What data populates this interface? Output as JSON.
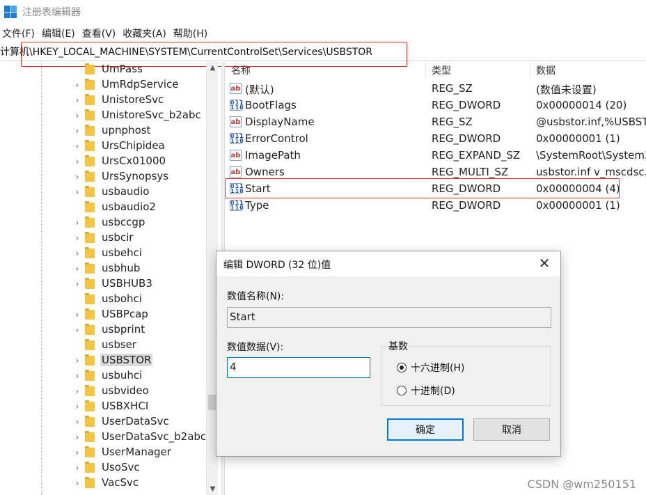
{
  "window": {
    "title": "注册表编辑器"
  },
  "menu": [
    {
      "label": "文件(F)"
    },
    {
      "label": "编辑(E)"
    },
    {
      "label": "查看(V)"
    },
    {
      "label": "收藏夹(A)"
    },
    {
      "label": "帮助(H)"
    }
  ],
  "address": {
    "path": "计算机\\HKEY_LOCAL_MACHINE\\SYSTEM\\CurrentControlSet\\Services\\USBSTOR"
  },
  "tree": {
    "items": [
      {
        "label": "UmPass",
        "expandable": false
      },
      {
        "label": "UmRdpService",
        "expandable": true
      },
      {
        "label": "UnistoreSvc",
        "expandable": true
      },
      {
        "label": "UnistoreSvc_b2abc",
        "expandable": true
      },
      {
        "label": "upnphost",
        "expandable": true
      },
      {
        "label": "UrsChipidea",
        "expandable": true
      },
      {
        "label": "UrsCx01000",
        "expandable": true
      },
      {
        "label": "UrsSynopsys",
        "expandable": true
      },
      {
        "label": "usbaudio",
        "expandable": true
      },
      {
        "label": "usbaudio2",
        "expandable": false
      },
      {
        "label": "usbccgp",
        "expandable": true
      },
      {
        "label": "usbcir",
        "expandable": true
      },
      {
        "label": "usbehci",
        "expandable": true
      },
      {
        "label": "usbhub",
        "expandable": true
      },
      {
        "label": "USBHUB3",
        "expandable": true
      },
      {
        "label": "usbohci",
        "expandable": false
      },
      {
        "label": "USBPcap",
        "expandable": true
      },
      {
        "label": "usbprint",
        "expandable": true
      },
      {
        "label": "usbser",
        "expandable": false
      },
      {
        "label": "USBSTOR",
        "expandable": true,
        "selected": true
      },
      {
        "label": "usbuhci",
        "expandable": true
      },
      {
        "label": "usbvideo",
        "expandable": true
      },
      {
        "label": "USBXHCI",
        "expandable": true
      },
      {
        "label": "UserDataSvc",
        "expandable": true
      },
      {
        "label": "UserDataSvc_b2abc",
        "expandable": true
      },
      {
        "label": "UserManager",
        "expandable": true
      },
      {
        "label": "UsoSvc",
        "expandable": true
      },
      {
        "label": "VacSvc",
        "expandable": true
      }
    ]
  },
  "list": {
    "columns": {
      "name": "名称",
      "type": "类型",
      "data": "数据"
    },
    "rows": [
      {
        "icon": "string-value-icon",
        "name": "(默认)",
        "type": "REG_SZ",
        "data": "(数值未设置)"
      },
      {
        "icon": "binary-value-icon",
        "name": "BootFlags",
        "type": "REG_DWORD",
        "data": "0x00000014 (20)"
      },
      {
        "icon": "string-value-icon",
        "name": "DisplayName",
        "type": "REG_SZ",
        "data": "@usbstor.inf,%USBST("
      },
      {
        "icon": "binary-value-icon",
        "name": "ErrorControl",
        "type": "REG_DWORD",
        "data": "0x00000001 (1)"
      },
      {
        "icon": "string-value-icon",
        "name": "ImagePath",
        "type": "REG_EXPAND_SZ",
        "data": "\\SystemRoot\\System3"
      },
      {
        "icon": "string-value-icon",
        "name": "Owners",
        "type": "REG_MULTI_SZ",
        "data": "usbstor.inf v_mscdsc.i"
      },
      {
        "icon": "binary-value-icon",
        "name": "Start",
        "type": "REG_DWORD",
        "data": "0x00000004 (4)"
      },
      {
        "icon": "binary-value-icon",
        "name": "Type",
        "type": "REG_DWORD",
        "data": "0x00000001 (1)"
      }
    ]
  },
  "dialog": {
    "title": "编辑 DWORD (32 位)值",
    "name_label": "数值名称(N):",
    "name_value": "Start",
    "data_label": "数值数据(V):",
    "data_value": "4",
    "base_label": "基数",
    "radio_hex": "十六进制(H)",
    "radio_dec": "十进制(D)",
    "selected_base": "hex",
    "ok": "确定",
    "cancel": "取消"
  },
  "watermark": "CSDN @wm250151",
  "colors": {
    "highlight": "#d9342b",
    "accent": "#0078d7"
  }
}
